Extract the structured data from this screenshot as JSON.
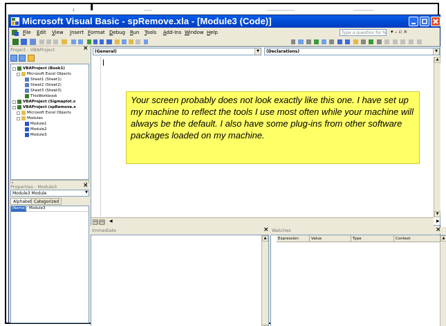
{
  "window": {
    "title": "Microsoft Visual Basic - spRemove.xla - [Module3 (Code)]"
  },
  "menu": {
    "items": [
      "File",
      "Edit",
      "View",
      "Insert",
      "Format",
      "Debug",
      "Run",
      "Tools",
      "Add-Ins",
      "Window",
      "Help"
    ],
    "help_placeholder": "Type a question for help",
    "right_controls": "▾ – ▫ ×"
  },
  "project": {
    "title": "Project - VBAProject",
    "tree": [
      {
        "label": "VBAProject (Book1)",
        "bold": true
      },
      {
        "label": "Microsoft Excel Objects",
        "bold": false
      },
      {
        "label": "Sheet1 (Sheet1)",
        "bold": false
      },
      {
        "label": "Sheet2 (Sheet2)",
        "bold": false
      },
      {
        "label": "Sheet3 (Sheet3)",
        "bold": false
      },
      {
        "label": "ThisWorkbook",
        "bold": false
      },
      {
        "label": "VBAProject (Sigmaplot.x",
        "bold": true
      },
      {
        "label": "VBAProject (spRemove.x",
        "bold": true
      },
      {
        "label": "Microsoft Excel Objects",
        "bold": false
      },
      {
        "label": "Modules",
        "bold": false
      },
      {
        "label": "Module1",
        "bold": false
      },
      {
        "label": "Module2",
        "bold": false
      },
      {
        "label": "Module3",
        "bold": false
      }
    ]
  },
  "properties": {
    "title": "Properties - Module3",
    "object_label": "Module3 Module",
    "tabs": [
      "Alphabetic",
      "Categorized"
    ],
    "rows": [
      {
        "key": "(Name)",
        "value": "Module3"
      }
    ]
  },
  "code": {
    "object_combo": "(General)",
    "proc_combo": "(Declarations)"
  },
  "note": {
    "text": "Your screen probably does not look exactly like this one. I have set up my machine to reflect the tools I use most often while your machine will always be the default. I also have some plug-ins from other software packages loaded on my machine."
  },
  "immediate": {
    "title": "Immediate"
  },
  "watches": {
    "title": "Watches",
    "columns": [
      "Expression",
      "Value",
      "Type",
      "Context"
    ]
  }
}
